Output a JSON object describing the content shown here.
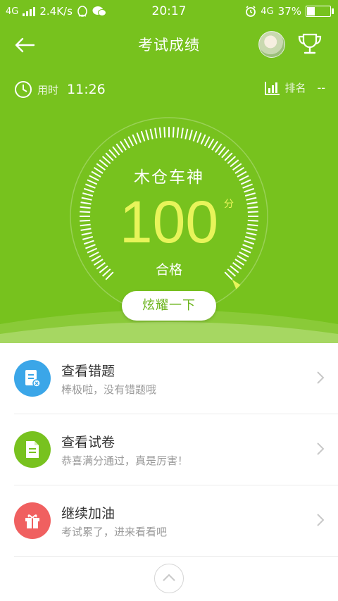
{
  "status_bar": {
    "network_left": "4G",
    "speed": "2.4K/s",
    "time": "20:17",
    "network_right": "4G",
    "battery": "37%",
    "battery_level": 0.37
  },
  "toolbar": {
    "title": "考试成绩"
  },
  "stats": {
    "time_label": "用时",
    "time_value": "11:26",
    "rank_label": "排名",
    "rank_value": "--"
  },
  "result": {
    "nickname": "木仓车神",
    "score": "100",
    "unit": "分",
    "status": "合格",
    "score_fraction": 1.0
  },
  "share_button": "炫耀一下",
  "list": [
    {
      "title": "查看错题",
      "subtitle": "棒极啦，没有错题哦",
      "icon": "wrong-answers-icon",
      "color": "#3ba6e8"
    },
    {
      "title": "查看试卷",
      "subtitle": "恭喜满分通过，真是厉害！",
      "icon": "exam-paper-icon",
      "color": "#78c21f"
    },
    {
      "title": "继续加油",
      "subtitle": "考试累了，进来看看吧",
      "icon": "gift-icon",
      "color": "#f06060"
    }
  ],
  "colors": {
    "brand_green": "#77c21e",
    "score_yellow": "#e8f45a"
  }
}
